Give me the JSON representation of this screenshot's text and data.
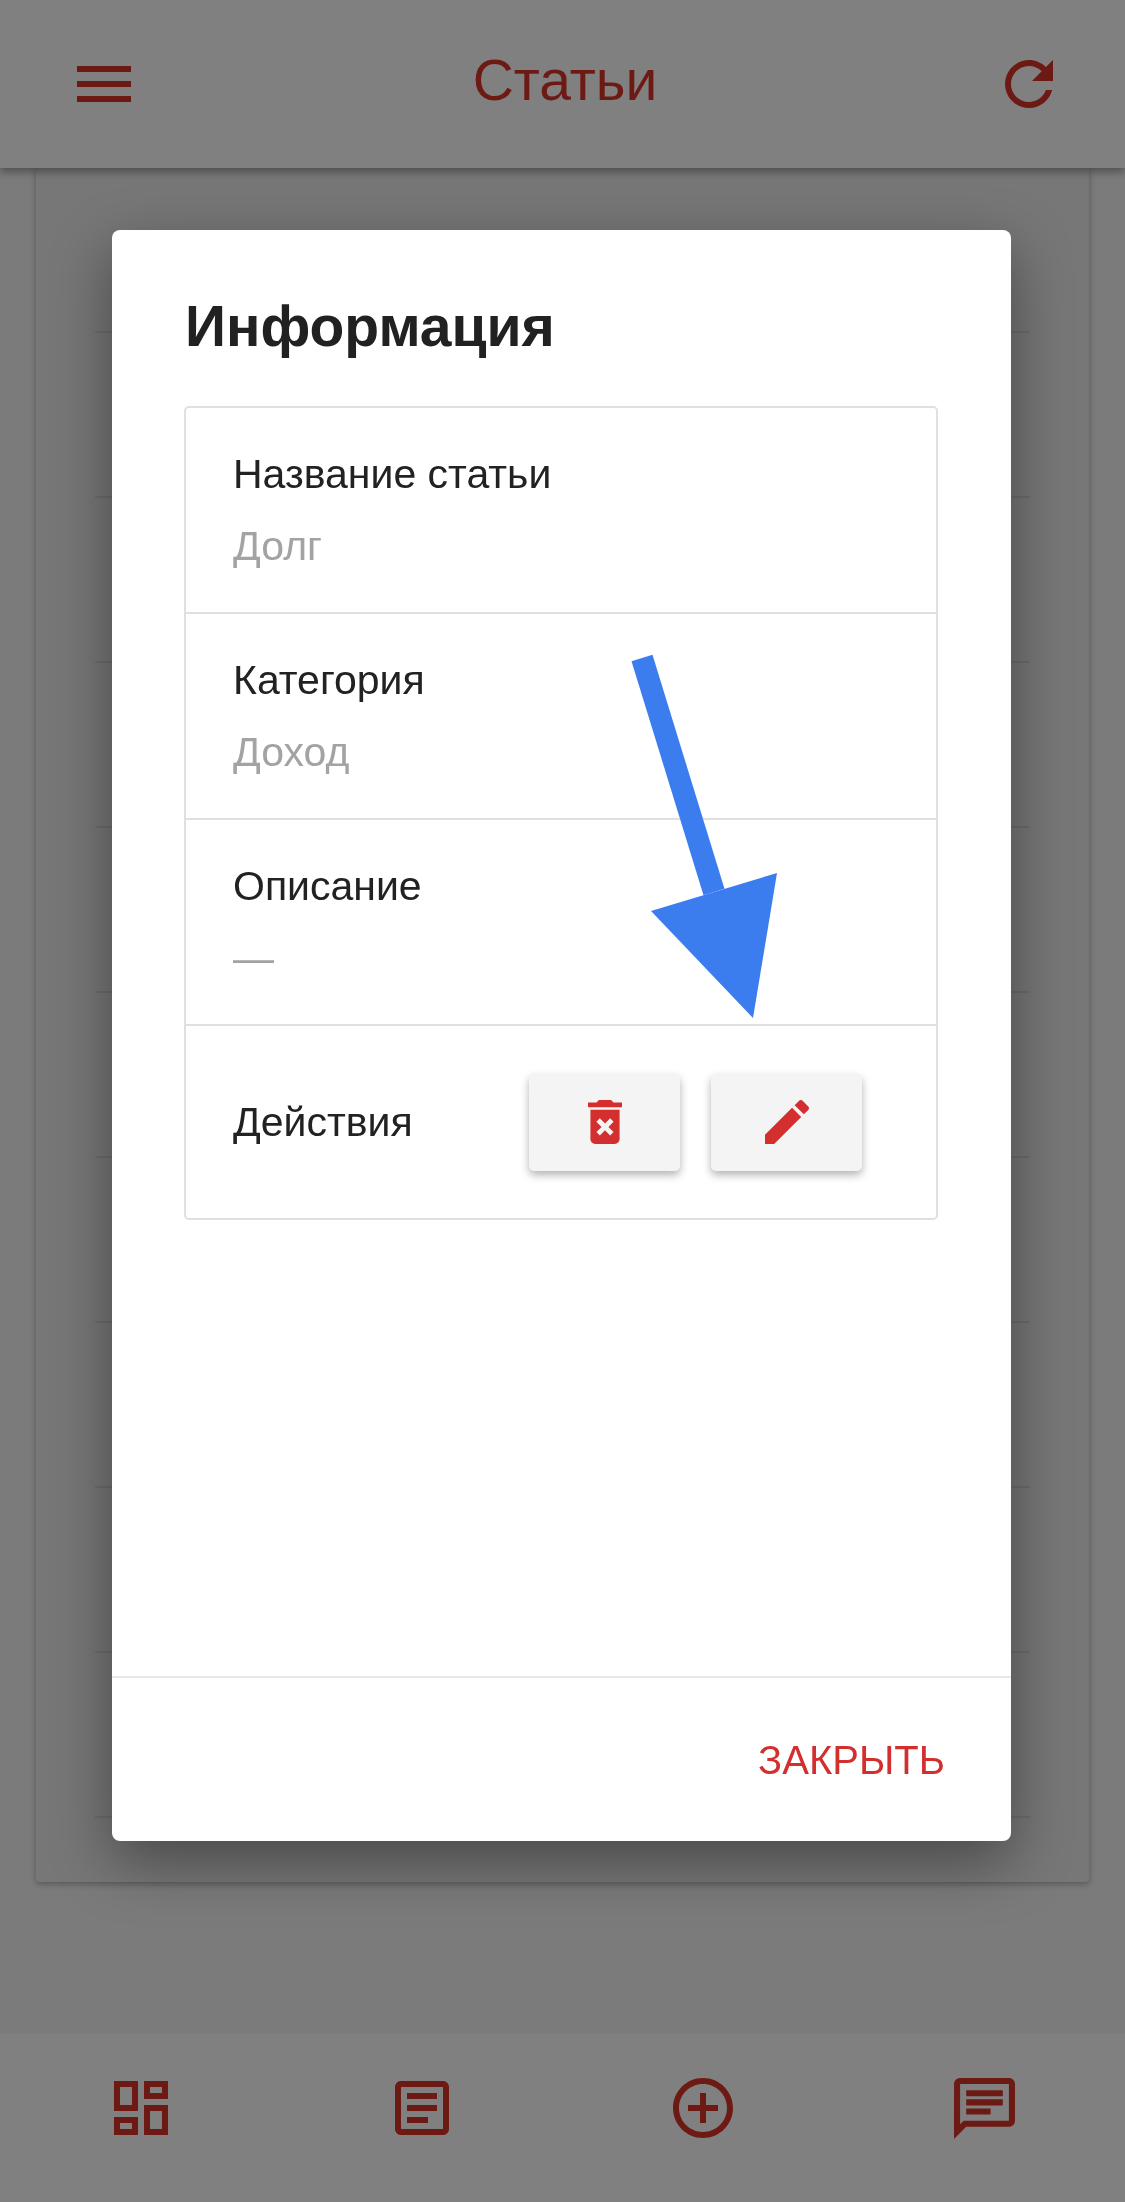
{
  "app_bar": {
    "title": "Статьи"
  },
  "dialog": {
    "title": "Информация",
    "fields": [
      {
        "label": "Название статьи",
        "value": "Долг"
      },
      {
        "label": "Категория",
        "value": "Доход"
      },
      {
        "label": "Описание",
        "value": "—"
      }
    ],
    "actions": {
      "label": "Действия",
      "buttons": [
        {
          "kind": "delete"
        },
        {
          "kind": "edit"
        }
      ]
    },
    "close_button": "ЗАКРЫТЬ"
  },
  "bottom_nav": [
    {
      "kind": "dashboard"
    },
    {
      "kind": "articles"
    },
    {
      "kind": "add"
    },
    {
      "kind": "messages"
    }
  ]
}
